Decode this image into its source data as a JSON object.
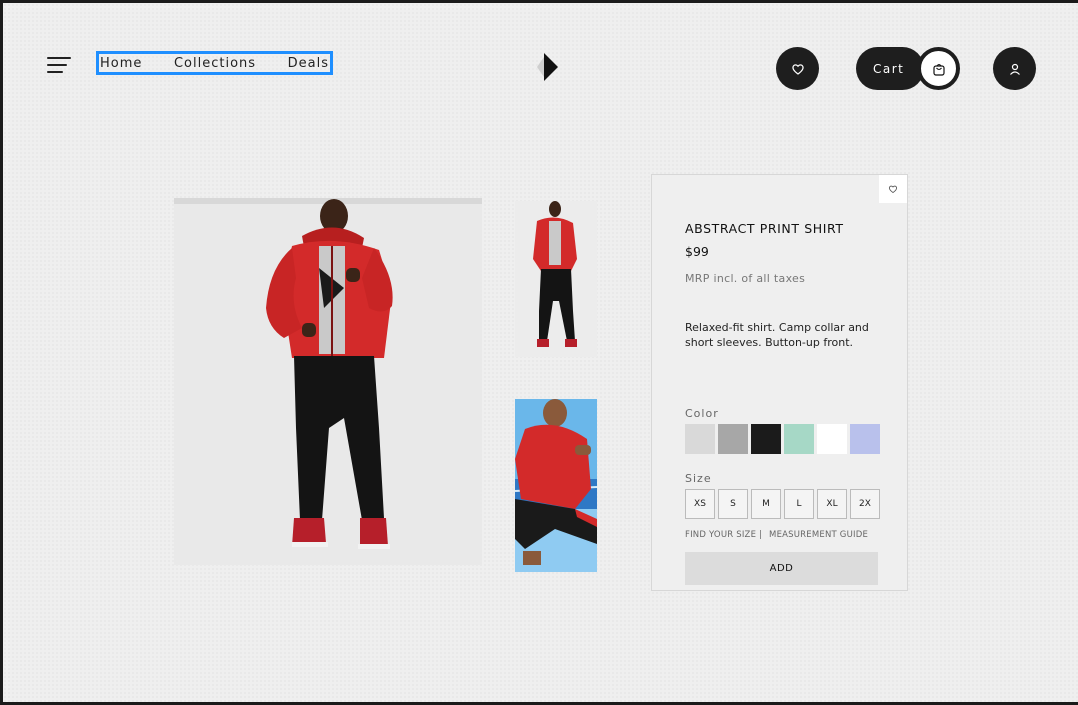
{
  "nav": {
    "items": [
      {
        "label": "Home"
      },
      {
        "label": "Collections"
      },
      {
        "label": "Deals"
      }
    ]
  },
  "header": {
    "cart_label": "Cart",
    "icons": [
      "menu-icon",
      "logo-icon",
      "favorite-icon",
      "bag-icon",
      "user-icon"
    ]
  },
  "product": {
    "title": "ABSTRACT PRINT SHIRT",
    "price": "$99",
    "tax_note": "MRP incl. of all taxes",
    "description": "Relaxed-fit shirt. Camp collar and short sleeves. Button-up front.",
    "color_label": "Color",
    "colors": [
      "#d9d9d9",
      "#a7a7a7",
      "#1b1b1b",
      "#a6d8c6",
      "#ffffff",
      "#b9c1ec"
    ],
    "size_label": "Size",
    "sizes": [
      "XS",
      "S",
      "M",
      "L",
      "XL",
      "2X"
    ],
    "find_size": "FIND YOUR SIZE |",
    "measurement_guide": "MEASUREMENT GUIDE",
    "add_label": "ADD"
  },
  "colors": {
    "nav_highlight": "#1f8fff",
    "dark": "#1e1e1e",
    "background": "#efefef",
    "jacket_red": "#d32a2a"
  }
}
